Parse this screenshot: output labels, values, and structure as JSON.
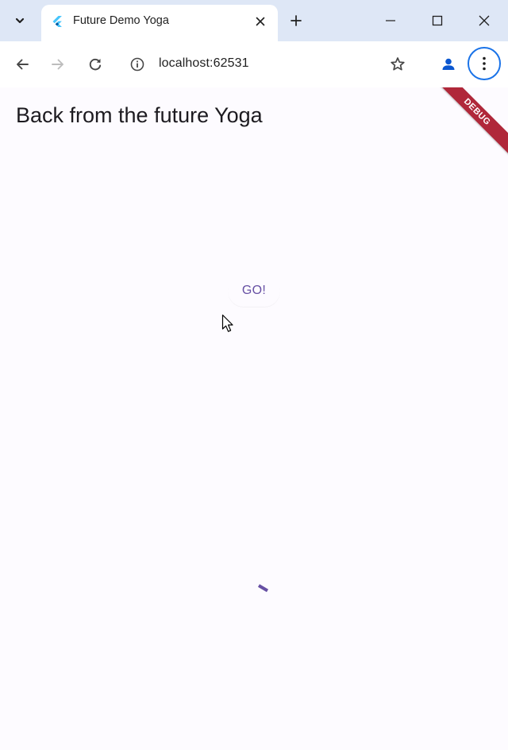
{
  "browser": {
    "tab": {
      "title": "Future Demo Yoga",
      "favicon": "flutter-icon"
    },
    "toolbar": {
      "url": "localhost:62531"
    },
    "icons": {
      "tab_search": "chevron-down-icon",
      "tab_close": "close-icon",
      "new_tab": "plus-icon",
      "minimize": "minimize-icon",
      "maximize": "maximize-icon",
      "close_window": "close-icon",
      "back": "arrow-left-icon",
      "forward": "arrow-right-icon",
      "reload": "reload-icon",
      "site_info": "info-icon",
      "bookmark": "star-icon",
      "profile": "person-icon",
      "menu": "more-vert-icon"
    }
  },
  "app": {
    "heading": "Back from the future Yoga",
    "go_button_label": "GO!",
    "debug_banner": "DEBUG",
    "colors": {
      "primary": "#6750a4",
      "background": "#fdfbff",
      "banner": "#b0283a"
    }
  }
}
